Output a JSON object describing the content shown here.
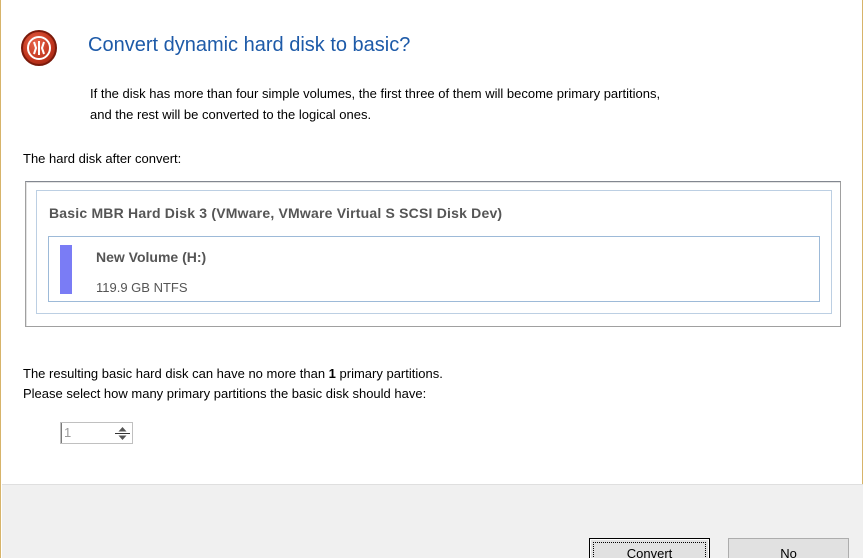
{
  "dialog": {
    "title": "Convert dynamic hard disk to basic?",
    "description_line1": "If the disk has more than four simple volumes, the first three of them will become primary partitions,",
    "description_line2": "and the rest will be converted to the logical ones.",
    "icon": "warning-app-icon"
  },
  "disk_section": {
    "label": "The hard disk after convert:",
    "disk_title": "Basic MBR Hard Disk 3 (VMware, VMware Virtual S SCSI Disk Dev)",
    "volume": {
      "name": "New Volume (H:)",
      "info": "119.9 GB NTFS",
      "color": "#7a7cf5"
    }
  },
  "partition_limit": {
    "text_before": "The resulting basic hard disk can have no more than ",
    "max_value": "1",
    "text_after": " primary partitions.",
    "prompt": "Please select how many primary partitions the basic disk should have:",
    "spinner_value": "1"
  },
  "buttons": {
    "convert_label": "Convert",
    "no_label": "No"
  },
  "colors": {
    "title": "#1d5aa8",
    "accent_border": "#d7b46a",
    "footer_bg": "#f0f0f0"
  }
}
